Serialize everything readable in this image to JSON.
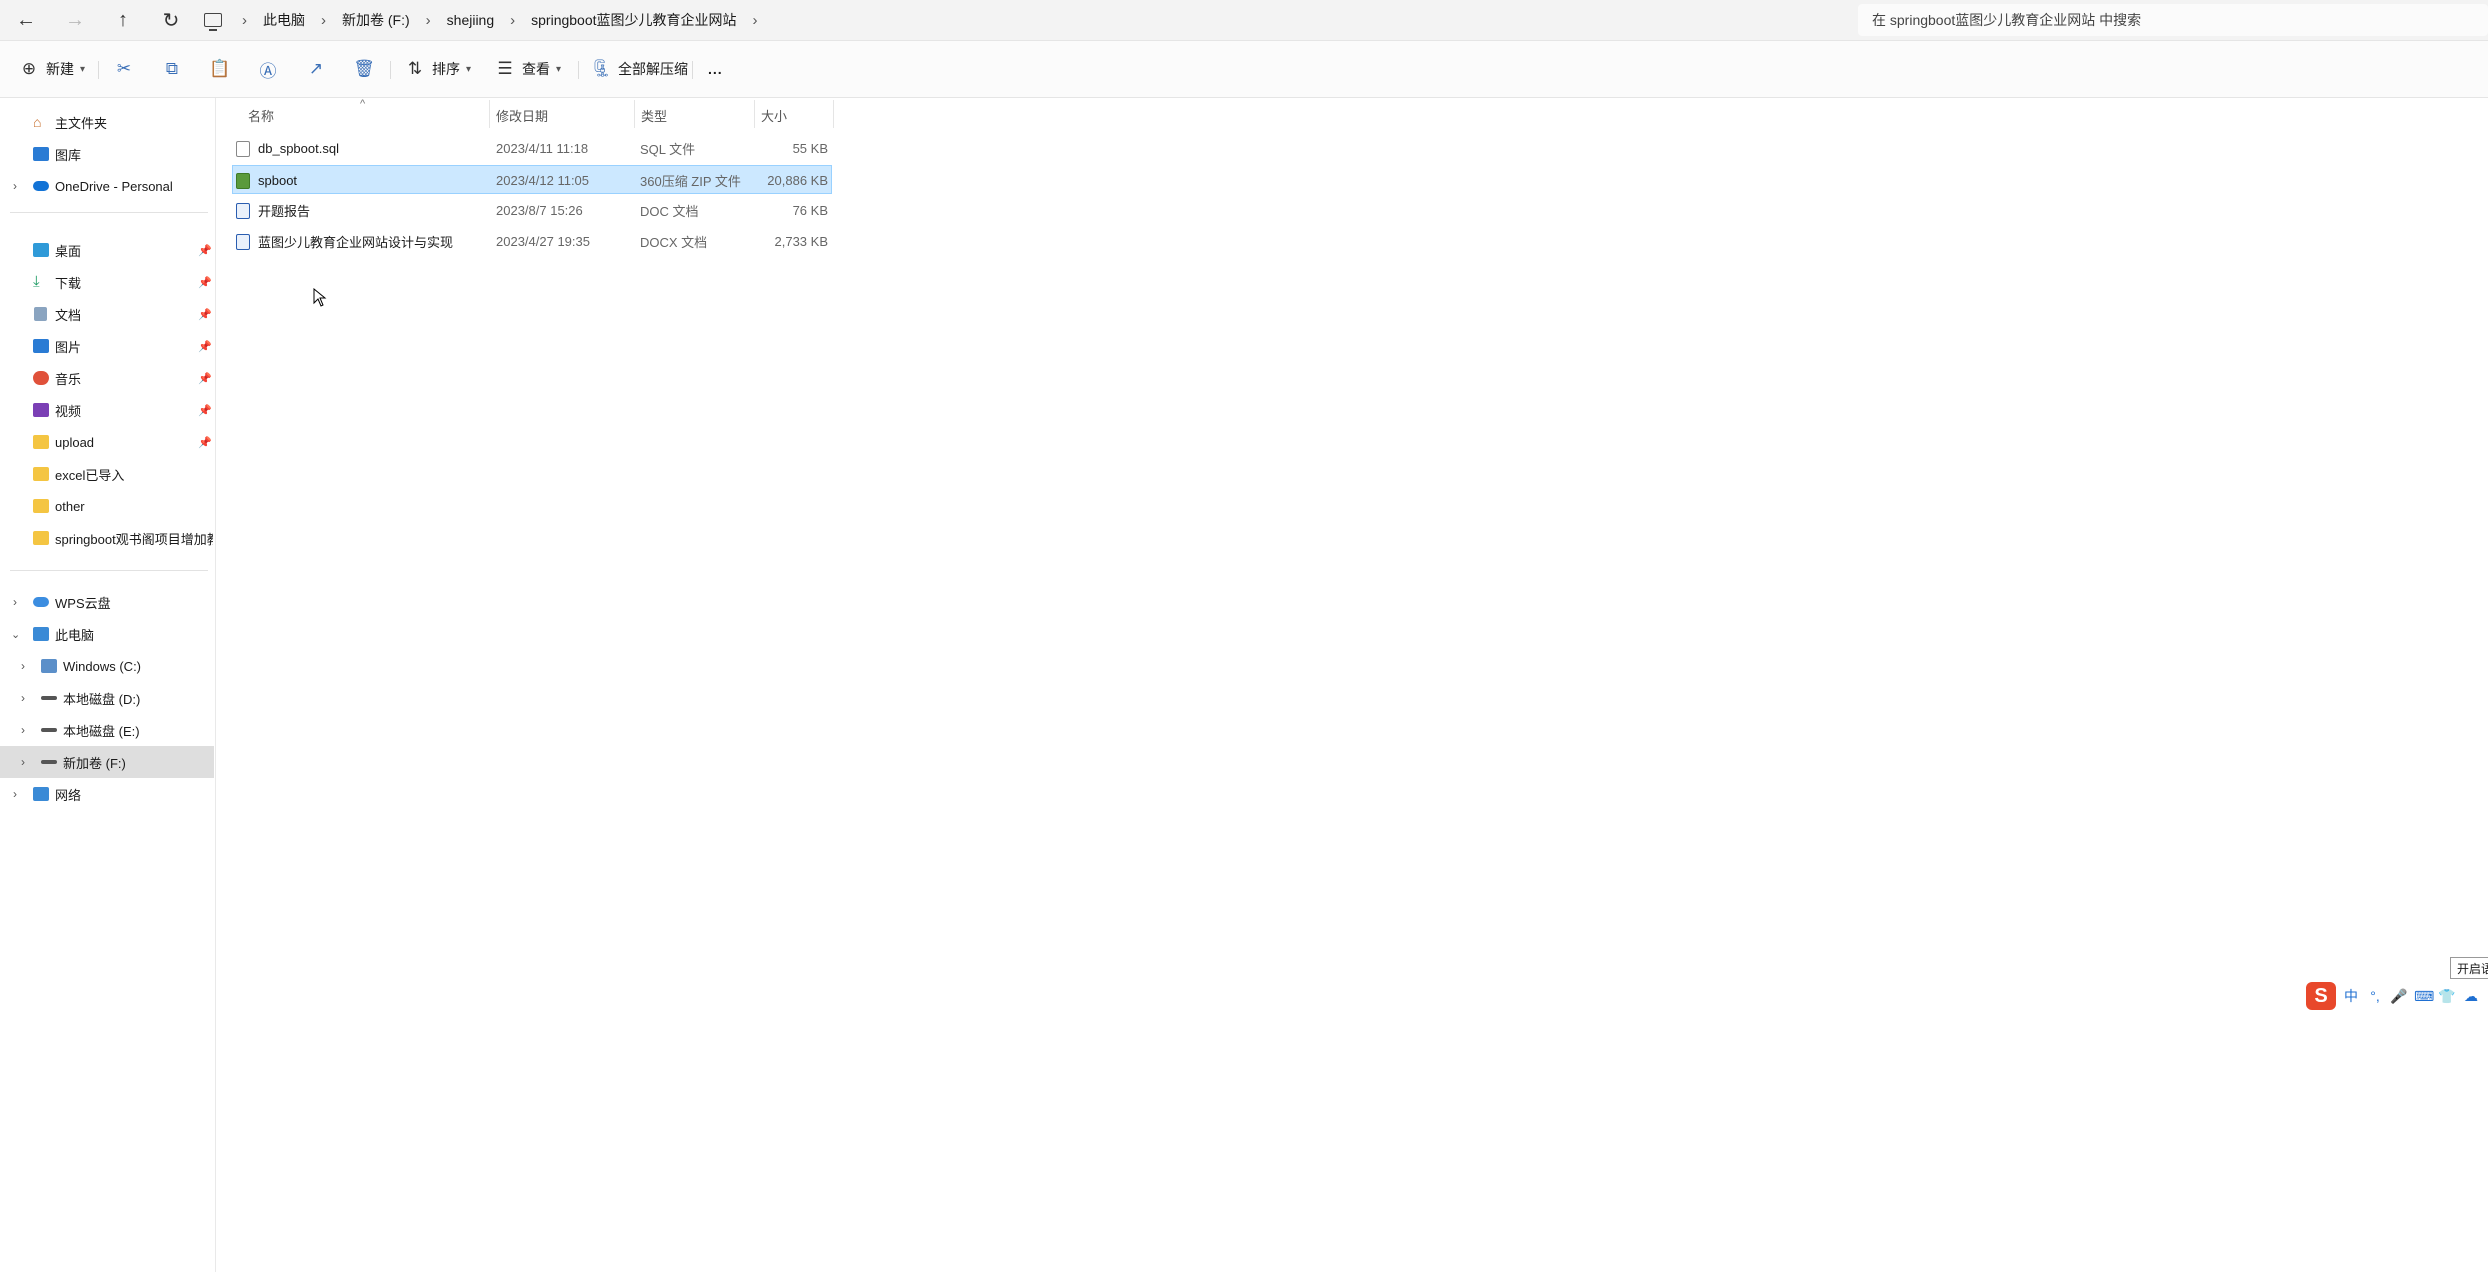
{
  "breadcrumbs": [
    "此电脑",
    "新加卷 (F:)",
    "shejiing",
    "springboot蓝图少儿教育企业网站"
  ],
  "search": {
    "placeholder": "在 springboot蓝图少儿教育企业网站 中搜索"
  },
  "toolbar": {
    "new_label": "新建",
    "sort_label": "排序",
    "view_label": "查看",
    "extract_label": "全部解压缩",
    "more_label": "..."
  },
  "sidebar": {
    "quick": [
      {
        "label": "主文件夹",
        "icon": "home-icon"
      },
      {
        "label": "图库",
        "icon": "gallery-icon"
      },
      {
        "label": "OneDrive - Personal",
        "icon": "onedrive-icon"
      }
    ],
    "pinned": [
      {
        "label": "桌面",
        "icon": "desktop-icon"
      },
      {
        "label": "下载",
        "icon": "download-icon"
      },
      {
        "label": "文档",
        "icon": "documents-icon"
      },
      {
        "label": "图片",
        "icon": "pictures-icon"
      },
      {
        "label": "音乐",
        "icon": "music-icon"
      },
      {
        "label": "视频",
        "icon": "videos-icon"
      },
      {
        "label": "upload",
        "icon": "folder-icon"
      },
      {
        "label": "excel已导入",
        "icon": "folder-icon"
      },
      {
        "label": "other",
        "icon": "folder-icon"
      },
      {
        "label": "springboot观书阁项目增加教",
        "icon": "folder-icon"
      }
    ],
    "tree": [
      {
        "label": "WPS云盘",
        "icon": "wps-cloud-icon"
      },
      {
        "label": "此电脑",
        "icon": "this-pc-icon"
      },
      {
        "label": "Windows (C:)",
        "icon": "windows-drive-icon"
      },
      {
        "label": "本地磁盘 (D:)",
        "icon": "drive-icon"
      },
      {
        "label": "本地磁盘 (E:)",
        "icon": "drive-icon"
      },
      {
        "label": "新加卷 (F:)",
        "icon": "drive-icon"
      },
      {
        "label": "网络",
        "icon": "network-icon"
      }
    ]
  },
  "columns": {
    "name": "名称",
    "date": "修改日期",
    "type": "类型",
    "size": "大小"
  },
  "files": [
    {
      "name": "db_spboot.sql",
      "date": "2023/4/11 11:18",
      "type": "SQL 文件",
      "size": "55 KB",
      "icon": "sql-file-icon"
    },
    {
      "name": "spboot",
      "date": "2023/4/12 11:05",
      "type": "360压缩 ZIP 文件",
      "size": "20,886 KB",
      "icon": "zip-file-icon"
    },
    {
      "name": "开题报告",
      "date": "2023/8/7 15:26",
      "type": "DOC 文档",
      "size": "76 KB",
      "icon": "doc-file-icon"
    },
    {
      "name": "蓝图少儿教育企业网站设计与实现",
      "date": "2023/4/27 19:35",
      "type": "DOCX 文档",
      "size": "2,733 KB",
      "icon": "docx-file-icon"
    }
  ],
  "ime": {
    "lang": "中",
    "tooltip": "开启语"
  },
  "colors": {
    "selection_bg": "#cce8ff",
    "selection_border": "#99d1ff",
    "nav_selected": "#dedede"
  }
}
